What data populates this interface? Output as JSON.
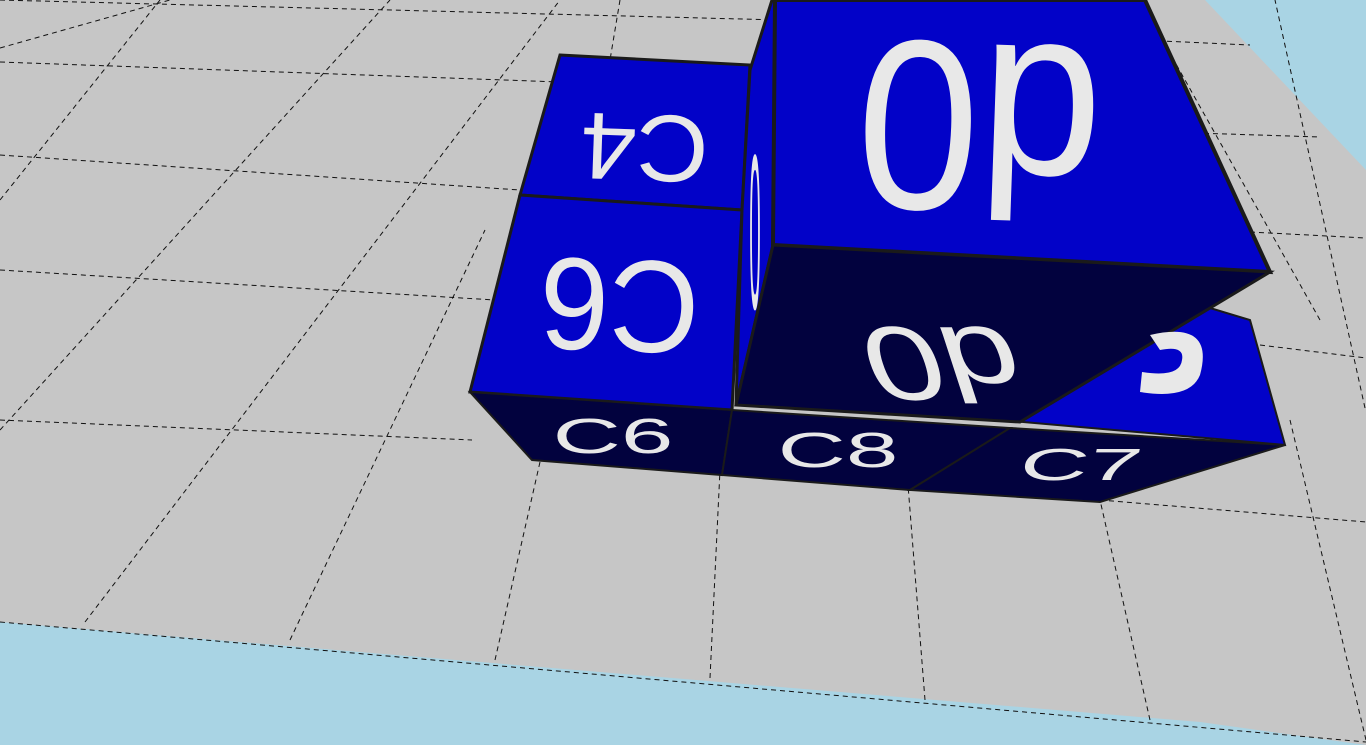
{
  "scene": {
    "colors": {
      "sky": "#a9d4e4",
      "floor": "#c6c6c6",
      "grid_line": "#111111",
      "cube_face": "#0202c8",
      "cube_face_shaded": "#02023e",
      "cube_edge": "#1a1a1a",
      "label": "#e8e8e8"
    },
    "labels": {
      "c4_top": "C4",
      "c6_top": "C6",
      "d0_top": "d0",
      "d0_front": "d0",
      "c6_front": "C6",
      "c8_front": "C8",
      "c7_front": "C7",
      "d0_side": "0"
    }
  }
}
